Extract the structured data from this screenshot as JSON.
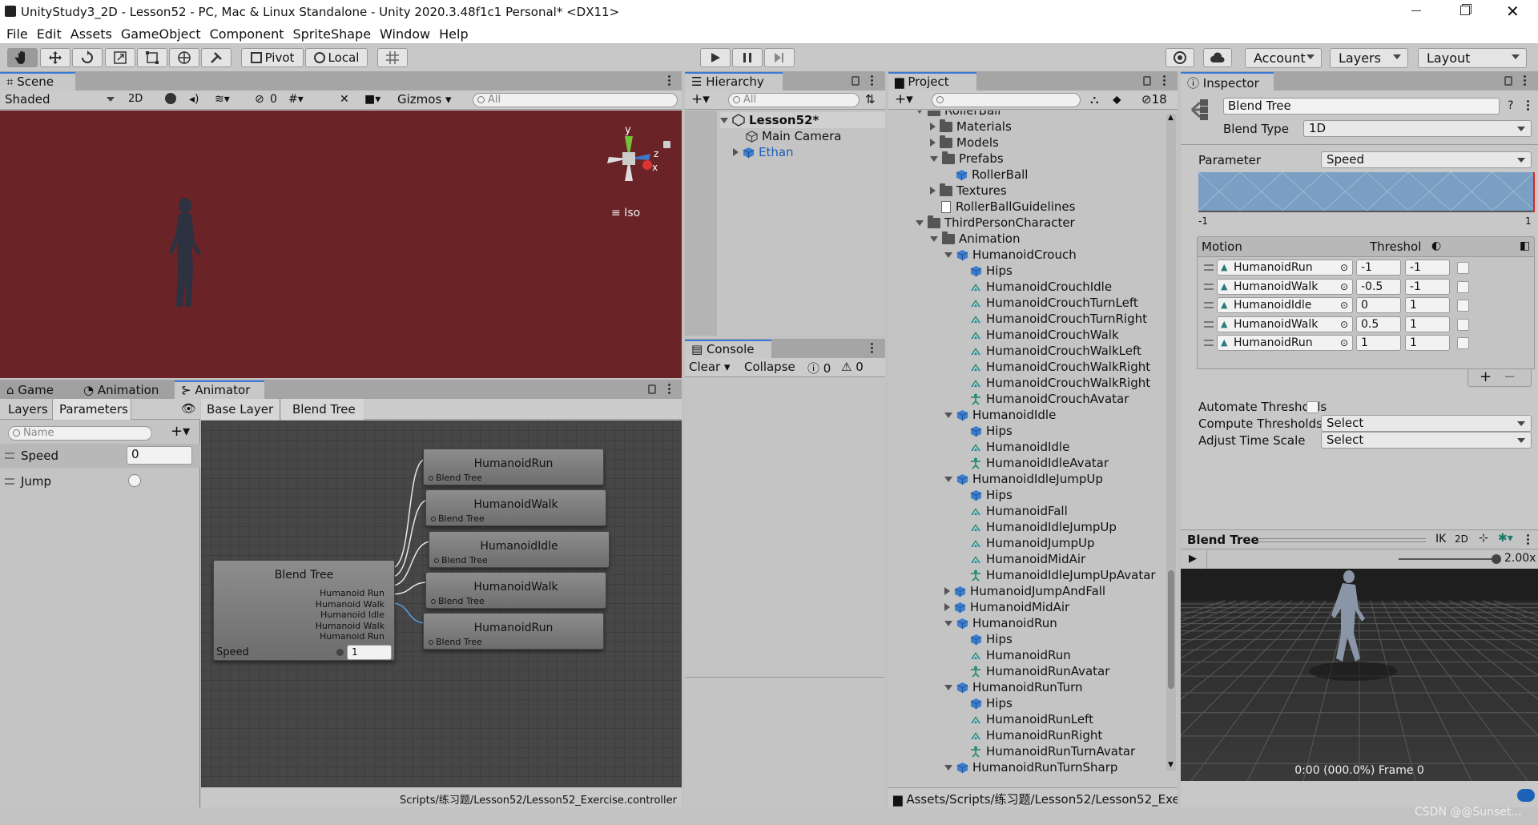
{
  "window": {
    "title": "UnityStudy3_2D - Lesson52 - PC, Mac & Linux Standalone - Unity 2020.3.48f1c1 Personal* <DX11>"
  },
  "menu": [
    "File",
    "Edit",
    "Assets",
    "GameObject",
    "Component",
    "SpriteShape",
    "Window",
    "Help"
  ],
  "toolbar": {
    "pivot": "Pivot",
    "local": "Local",
    "account": "Account",
    "layers": "Layers",
    "layout": "Layout"
  },
  "scene": {
    "tab": "Scene",
    "shading": "Shaded",
    "mode_2d": "2D",
    "hidden_count": "0",
    "gizmos": "Gizmos",
    "search_placeholder": "All",
    "axis_y": "y",
    "axis_z": "z",
    "axis_x": "x",
    "projection": "Iso",
    "background": "#6a2428"
  },
  "hierarchy": {
    "tab": "Hierarchy",
    "search_placeholder": "All",
    "scene_name": "Lesson52*",
    "items": [
      "Main Camera",
      "Ethan"
    ]
  },
  "console": {
    "tab": "Console",
    "clear": "Clear",
    "collapse": "Collapse",
    "errors": "0",
    "warnings": "0"
  },
  "bottom_tabs": {
    "game": "Game",
    "animation": "Animation",
    "animator": "Animator"
  },
  "animator": {
    "layers_tab": "Layers",
    "parameters_tab": "Parameters",
    "name_placeholder": "Name",
    "breadcrumb": [
      "Base Layer",
      "Blend Tree"
    ],
    "params": [
      {
        "name": "Speed",
        "value": "0"
      },
      {
        "name": "Jump",
        "value": ""
      }
    ],
    "blend_node": {
      "title": "Blend Tree",
      "outputs": [
        "Humanoid Run",
        "Humanoid Walk",
        "Humanoid Idle",
        "Humanoid Walk",
        "Humanoid Run"
      ],
      "param": "Speed",
      "value": "1"
    },
    "child_nodes": [
      {
        "title": "HumanoidRun",
        "sub": "Blend Tree"
      },
      {
        "title": "HumanoidWalk",
        "sub": "Blend Tree"
      },
      {
        "title": "HumanoidIdle",
        "sub": "Blend Tree"
      },
      {
        "title": "HumanoidWalk",
        "sub": "Blend Tree"
      },
      {
        "title": "HumanoidRun",
        "sub": "Blend Tree"
      }
    ],
    "footer": "Scripts/练习题/Lesson52/Lesson52_Exercise.controller"
  },
  "project": {
    "tab": "Project",
    "hidden_count": "18",
    "footer": "Assets/Scripts/练习题/Lesson52/Lesson52_Exe",
    "tree": [
      {
        "label": "RollerBall",
        "icon": "folder",
        "tri": "down",
        "indent": 0
      },
      {
        "label": "Materials",
        "icon": "folder",
        "tri": "right",
        "indent": 1
      },
      {
        "label": "Models",
        "icon": "folder",
        "tri": "right",
        "indent": 1
      },
      {
        "label": "Prefabs",
        "icon": "folder",
        "tri": "down",
        "indent": 1
      },
      {
        "label": "RollerBall",
        "icon": "prefab",
        "tri": "",
        "indent": 2
      },
      {
        "label": "Textures",
        "icon": "folder",
        "tri": "right",
        "indent": 1
      },
      {
        "label": "RollerBallGuidelines",
        "icon": "doc",
        "tri": "",
        "indent": 1
      },
      {
        "label": "ThirdPersonCharacter",
        "icon": "folder",
        "tri": "down",
        "indent": 0
      },
      {
        "label": "Animation",
        "icon": "folder",
        "tri": "down",
        "indent": 1
      },
      {
        "label": "HumanoidCrouch",
        "icon": "model",
        "tri": "down",
        "indent": 2
      },
      {
        "label": "Hips",
        "icon": "model",
        "tri": "",
        "indent": 3
      },
      {
        "label": "HumanoidCrouchIdle",
        "icon": "clip",
        "tri": "",
        "indent": 3
      },
      {
        "label": "HumanoidCrouchTurnLeft",
        "icon": "clip",
        "tri": "",
        "indent": 3
      },
      {
        "label": "HumanoidCrouchTurnRight",
        "icon": "clip",
        "tri": "",
        "indent": 3
      },
      {
        "label": "HumanoidCrouchWalk",
        "icon": "clip",
        "tri": "",
        "indent": 3
      },
      {
        "label": "HumanoidCrouchWalkLeft",
        "icon": "clip",
        "tri": "",
        "indent": 3
      },
      {
        "label": "HumanoidCrouchWalkRight",
        "icon": "clip",
        "tri": "",
        "indent": 3
      },
      {
        "label": "HumanoidCrouchWalkRight",
        "icon": "clip",
        "tri": "",
        "indent": 3
      },
      {
        "label": "HumanoidCrouchAvatar",
        "icon": "avatar",
        "tri": "",
        "indent": 3
      },
      {
        "label": "HumanoidIdle",
        "icon": "model",
        "tri": "down",
        "indent": 2
      },
      {
        "label": "Hips",
        "icon": "model",
        "tri": "",
        "indent": 3
      },
      {
        "label": "HumanoidIdle",
        "icon": "clip",
        "tri": "",
        "indent": 3
      },
      {
        "label": "HumanoidIdleAvatar",
        "icon": "avatar",
        "tri": "",
        "indent": 3
      },
      {
        "label": "HumanoidIdleJumpUp",
        "icon": "model",
        "tri": "down",
        "indent": 2
      },
      {
        "label": "Hips",
        "icon": "model",
        "tri": "",
        "indent": 3
      },
      {
        "label": "HumanoidFall",
        "icon": "clip",
        "tri": "",
        "indent": 3
      },
      {
        "label": "HumanoidIdleJumpUp",
        "icon": "clip",
        "tri": "",
        "indent": 3
      },
      {
        "label": "HumanoidJumpUp",
        "icon": "clip",
        "tri": "",
        "indent": 3
      },
      {
        "label": "HumanoidMidAir",
        "icon": "clip",
        "tri": "",
        "indent": 3
      },
      {
        "label": "HumanoidIdleJumpUpAvatar",
        "icon": "avatar",
        "tri": "",
        "indent": 3
      },
      {
        "label": "HumanoidJumpAndFall",
        "icon": "model",
        "tri": "right",
        "indent": 2
      },
      {
        "label": "HumanoidMidAir",
        "icon": "model",
        "tri": "right",
        "indent": 2
      },
      {
        "label": "HumanoidRun",
        "icon": "model",
        "tri": "down",
        "indent": 2
      },
      {
        "label": "Hips",
        "icon": "model",
        "tri": "",
        "indent": 3
      },
      {
        "label": "HumanoidRun",
        "icon": "clip",
        "tri": "",
        "indent": 3
      },
      {
        "label": "HumanoidRunAvatar",
        "icon": "avatar",
        "tri": "",
        "indent": 3
      },
      {
        "label": "HumanoidRunTurn",
        "icon": "model",
        "tri": "down",
        "indent": 2
      },
      {
        "label": "Hips",
        "icon": "model",
        "tri": "",
        "indent": 3
      },
      {
        "label": "HumanoidRunLeft",
        "icon": "clip",
        "tri": "",
        "indent": 3
      },
      {
        "label": "HumanoidRunRight",
        "icon": "clip",
        "tri": "",
        "indent": 3
      },
      {
        "label": "HumanoidRunTurnAvatar",
        "icon": "avatar",
        "tri": "",
        "indent": 3
      },
      {
        "label": "HumanoidRunTurnSharp",
        "icon": "model",
        "tri": "down",
        "indent": 2
      }
    ]
  },
  "inspector": {
    "tab": "Inspector",
    "name": "Blend Tree",
    "blend_type_label": "Blend Type",
    "blend_type": "1D",
    "parameter_label": "Parameter",
    "parameter": "Speed",
    "range_min": "-1",
    "range_max": "1",
    "motion_header": "Motion",
    "threshold_header": "Threshol",
    "motions": [
      {
        "clip": "HumanoidRun",
        "threshold": "-1",
        "speed": "-1"
      },
      {
        "clip": "HumanoidWalk",
        "threshold": "-0.5",
        "speed": "-1"
      },
      {
        "clip": "HumanoidIdle",
        "threshold": "0",
        "speed": "1"
      },
      {
        "clip": "HumanoidWalk",
        "threshold": "0.5",
        "speed": "1"
      },
      {
        "clip": "HumanoidRun",
        "threshold": "1",
        "speed": "1"
      }
    ],
    "automate_label": "Automate Thresholds",
    "compute_label": "Compute Thresholds",
    "compute_value": "Select",
    "adjust_label": "Adjust Time Scale",
    "adjust_value": "Select",
    "preview_title": "Blend Tree",
    "ik": "IK",
    "mode_2d": "2D",
    "speed": "2.00x",
    "frame": "0:00 (000.0%) Frame 0"
  },
  "watermark": "CSDN @@Sunset..."
}
